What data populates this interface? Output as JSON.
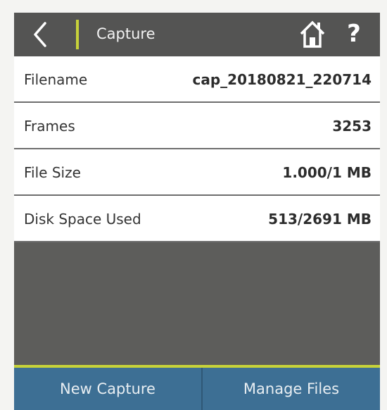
{
  "header": {
    "title": "Capture",
    "back_icon": "chevron-left-icon",
    "home_icon": "home-icon",
    "help_label": "?"
  },
  "rows": [
    {
      "label": "Filename",
      "value": "cap_20180821_220714"
    },
    {
      "label": "Frames",
      "value": "3253"
    },
    {
      "label": "File Size",
      "value": "1.000/1 MB"
    },
    {
      "label": "Disk Space Used",
      "value": "513/2691 MB"
    }
  ],
  "footer": {
    "new_capture_label": "New Capture",
    "manage_files_label": "Manage Files"
  },
  "colors": {
    "accent": "#c7d23a",
    "header_bg": "#545453",
    "footer_bg": "#3d6f94",
    "content_bg": "#5d5d5b"
  }
}
